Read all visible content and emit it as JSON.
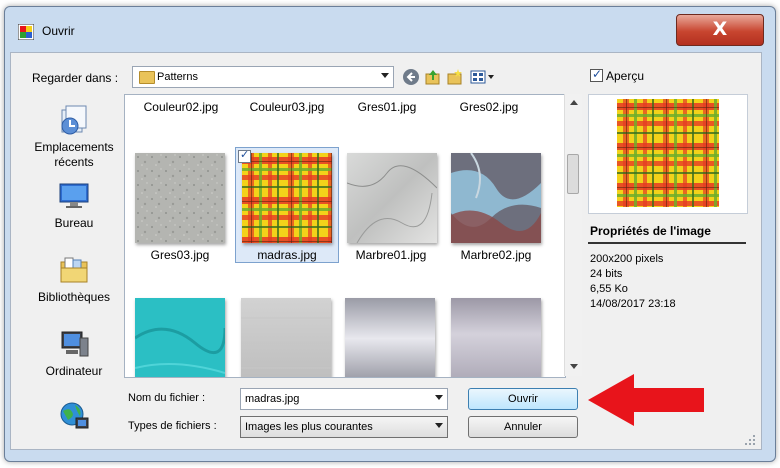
{
  "window": {
    "title": "Ouvrir",
    "close_glyph": "X"
  },
  "toolbar": {
    "lookin_label": "Regarder dans :",
    "lookin_value": "Patterns",
    "icons": [
      "back-icon",
      "up-folder-icon",
      "new-folder-icon",
      "view-menu-icon"
    ]
  },
  "preview": {
    "checkbox_label": "Aperçu",
    "checked": true
  },
  "places": [
    {
      "label": "Emplacements récents",
      "icon": "recent-places-icon"
    },
    {
      "label": "Bureau",
      "icon": "desktop-icon"
    },
    {
      "label": "Bibliothèques",
      "icon": "libraries-icon"
    },
    {
      "label": "Ordinateur",
      "icon": "computer-icon"
    },
    {
      "label": "",
      "icon": "network-icon"
    }
  ],
  "files": {
    "top_row": [
      "Couleur02.jpg",
      "Couleur03.jpg",
      "Gres01.jpg",
      "Gres02.jpg"
    ],
    "row2": [
      "Gres03.jpg",
      "madras.jpg",
      "Marbre01.jpg",
      "Marbre02.jpg"
    ],
    "selected": "madras.jpg"
  },
  "properties": {
    "title": "Propriétés de l'image",
    "dimensions": "200x200 pixels",
    "bits": "24 bits",
    "size": "6,55 Ko",
    "date": "14/08/2017 23:18"
  },
  "bottom": {
    "filename_label": "Nom du fichier :",
    "filename_value": "madras.jpg",
    "filetype_label": "Types de fichiers :",
    "filetype_value": "Images les plus courantes",
    "open_label": "Ouvrir",
    "cancel_label": "Annuler"
  },
  "colors": {
    "annotation_arrow": "#e8141b",
    "selection": "#dde9f8"
  }
}
